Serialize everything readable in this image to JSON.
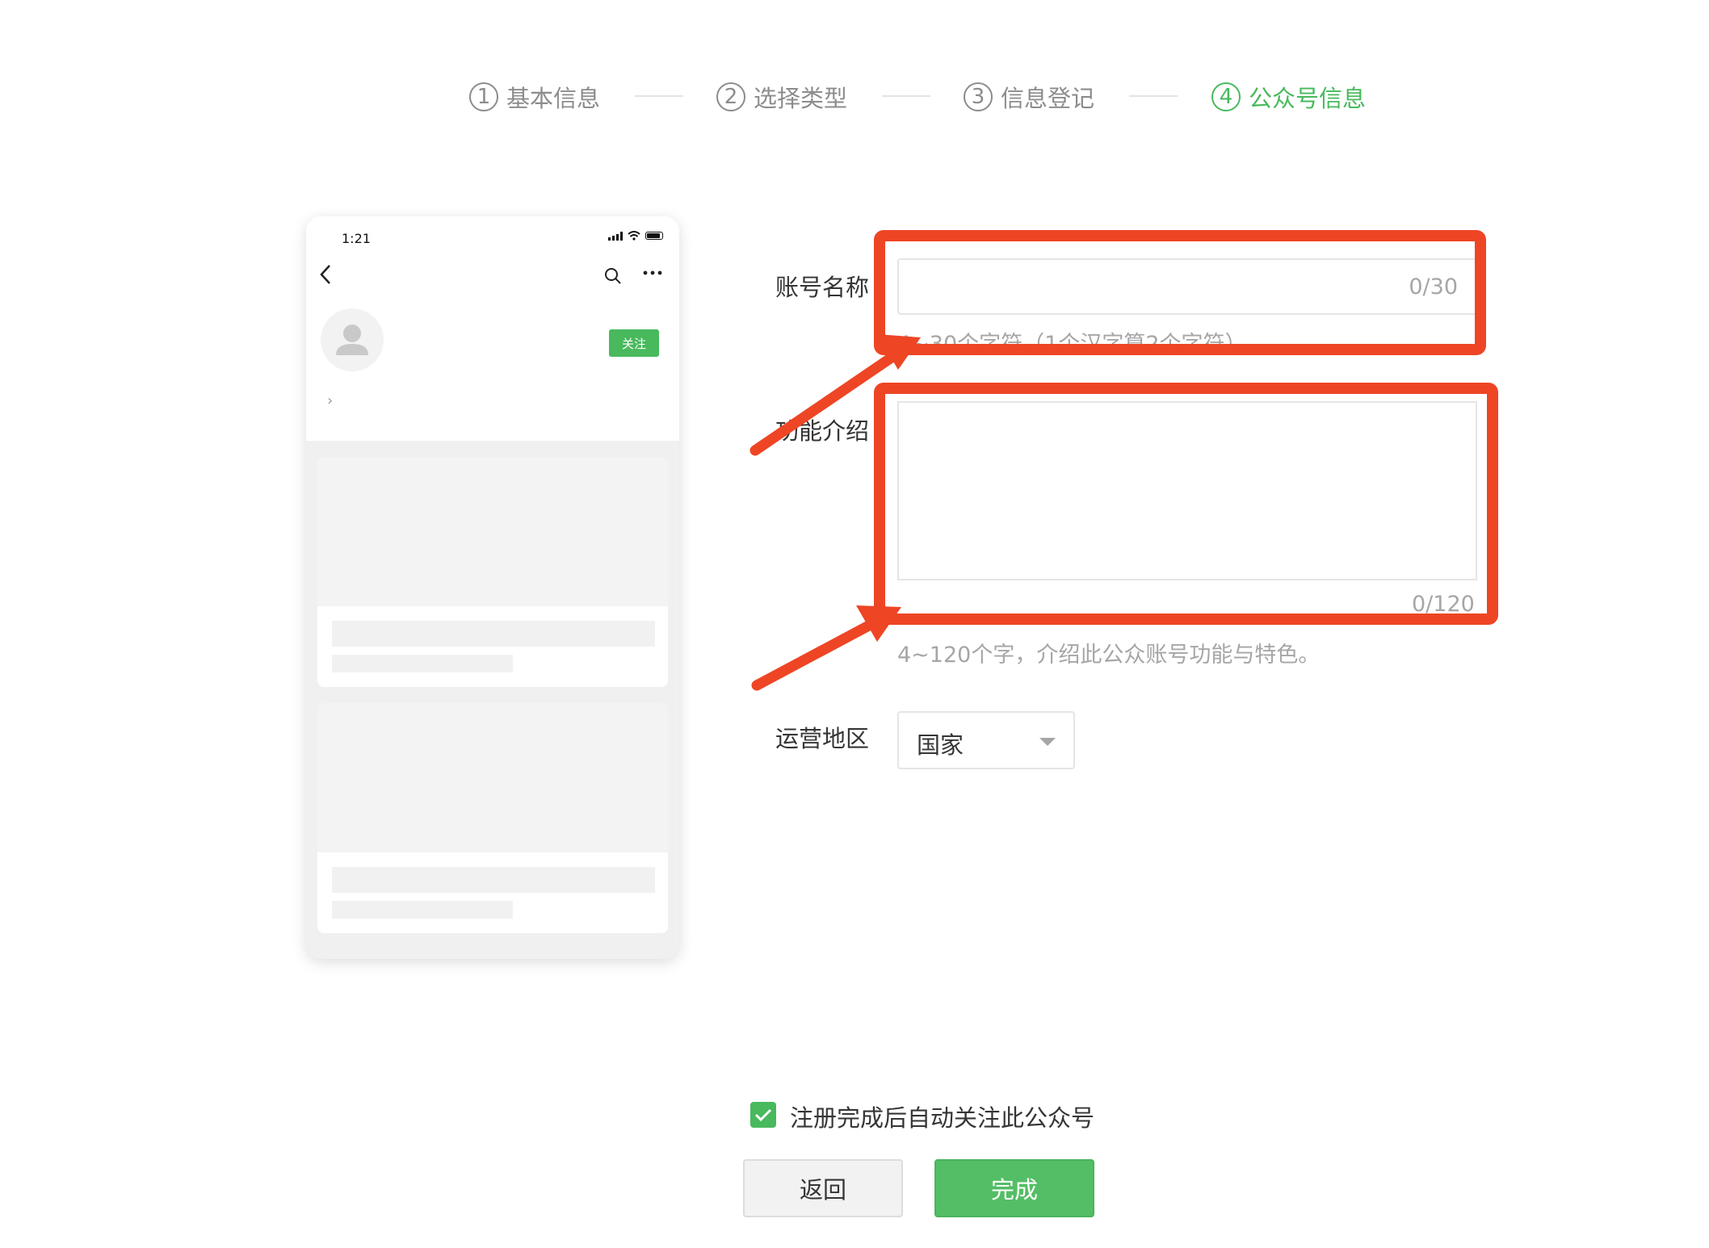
{
  "steps": [
    {
      "num": "1",
      "label": "基本信息",
      "active": false
    },
    {
      "num": "2",
      "label": "选择类型",
      "active": false
    },
    {
      "num": "3",
      "label": "信息登记",
      "active": false
    },
    {
      "num": "4",
      "label": "公众号信息",
      "active": true
    }
  ],
  "preview": {
    "time": "1:21",
    "follow_label": "关注",
    "chevron": "›"
  },
  "form": {
    "name": {
      "label": "账号名称",
      "counter": "0/30",
      "hint": "4~30个字符（1个汉字算2个字符）"
    },
    "intro": {
      "label": "功能介绍",
      "counter": "0/120",
      "hint": "4~120个字，介绍此公众账号功能与特色。"
    },
    "region": {
      "label": "运营地区",
      "value": "国家"
    }
  },
  "auto_follow": {
    "checked": true,
    "label": "注册完成后自动关注此公众号"
  },
  "buttons": {
    "back": "返回",
    "done": "完成"
  },
  "colors": {
    "accent_green": "#48b95c",
    "annotation_red": "#ee4525"
  },
  "icons": [
    "back-arrow-icon",
    "search-icon",
    "more-icon",
    "avatar-icon",
    "check-icon",
    "dropdown-caret-icon"
  ]
}
